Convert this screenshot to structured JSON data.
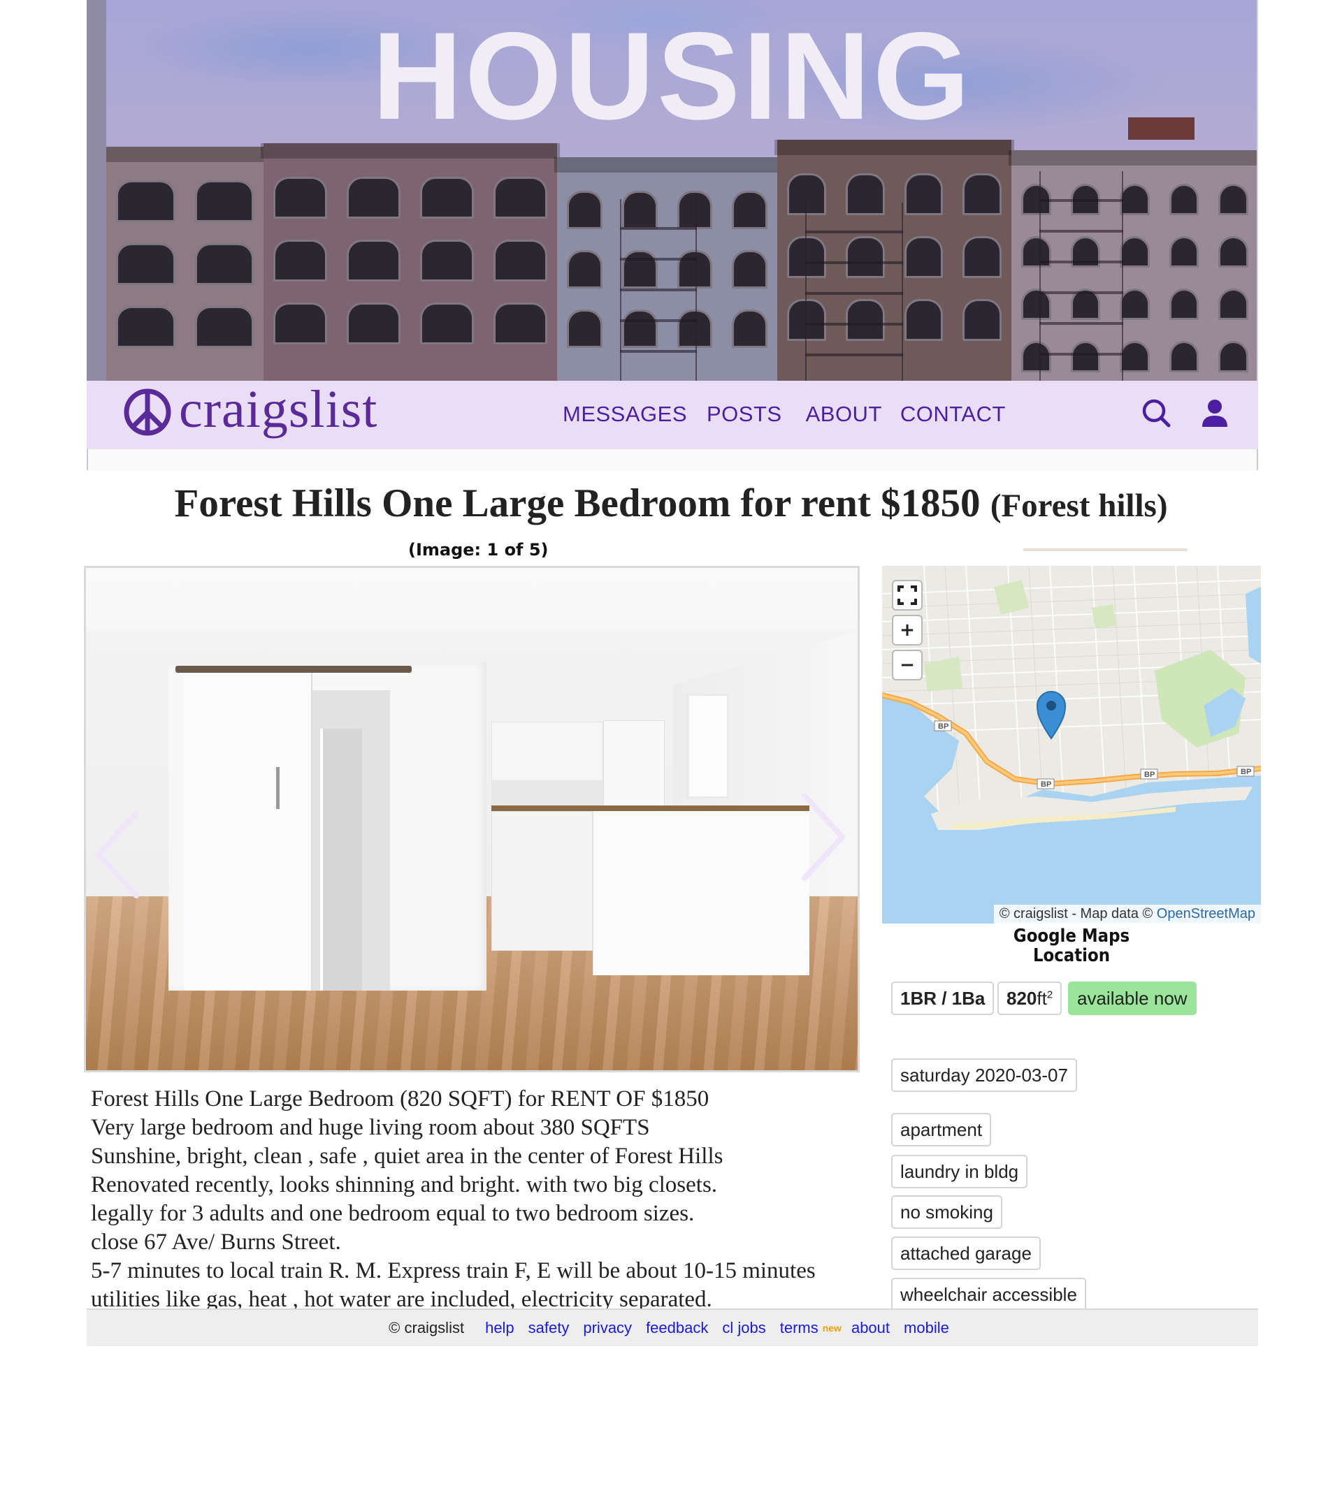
{
  "hero": {
    "title": "HOUSING"
  },
  "nav": {
    "logo_text": "craigslist",
    "menu": [
      "MESSAGES",
      "POSTS",
      "ABOUT",
      "CONTACT"
    ],
    "icons": [
      "search-icon",
      "user-icon"
    ]
  },
  "post": {
    "title": "Forest Hills One Large Bedroom for rent $1850",
    "hood": "(Forest hills)",
    "image_counter": "(Image: 1 of 5)",
    "body_lines": [
      "Forest Hills One Large Bedroom (820 SQFT) for RENT OF $1850",
      "Very large bedroom and huge living room about 380 SQFTS",
      "Sunshine, bright, clean , safe , quiet area in the center of Forest Hills",
      "Renovated recently, looks shinning and bright. with two big closets.",
      "legally for 3 adults and one bedroom equal to two bedroom sizes.",
      "close 67 Ave/ Burns Street.",
      "5-7 minutes to local train R. M. Express train F, E will be about 10-15 minutes",
      "utilities like gas, heat , hot water are included, electricity separated."
    ]
  },
  "map": {
    "attribution_prefix": "© craigslist - Map data © ",
    "attribution_link": "OpenStreetMap",
    "caption_line1": "Google Maps",
    "caption_line2": "Location",
    "road_label": "BP",
    "controls": [
      "fullscreen-icon",
      "zoom-in-icon",
      "zoom-out-icon"
    ]
  },
  "attributes": {
    "bedbath": "1BR / 1Ba",
    "sqft": "820",
    "sqft_unit": "ft",
    "sqft_sup": "2",
    "availability": "available now",
    "date": "saturday 2020-03-07",
    "tags": [
      "apartment",
      "laundry in bldg",
      "no smoking",
      "attached garage",
      "wheelchair accessible"
    ]
  },
  "footer": {
    "copyright": "© craigslist",
    "links": [
      "help",
      "safety",
      "privacy",
      "feedback",
      "cl jobs",
      "terms",
      "about",
      "mobile"
    ],
    "new_badge": "new"
  },
  "colors": {
    "nav_bg": "#e9def6",
    "brand_purple": "#5a2a98",
    "menu_purple": "#4b1fa0",
    "available_green": "#9be59a",
    "link_blue": "#1a1ad8",
    "new_orange": "#f0a000"
  }
}
